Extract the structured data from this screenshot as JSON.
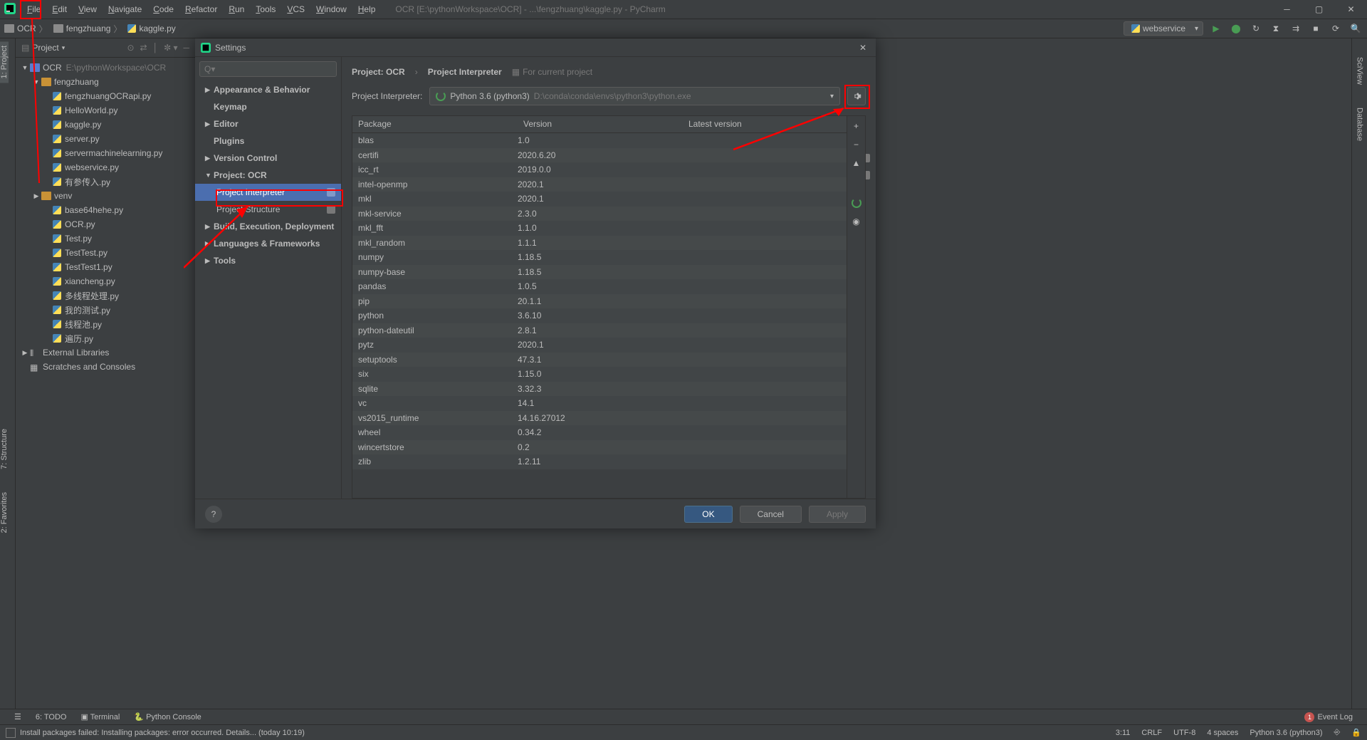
{
  "menu": [
    "File",
    "Edit",
    "View",
    "Navigate",
    "Code",
    "Refactor",
    "Run",
    "Tools",
    "VCS",
    "Window",
    "Help"
  ],
  "title": "OCR [E:\\pythonWorkspace\\OCR] - ...\\fengzhuang\\kaggle.py - PyCharm",
  "breadcrumb": {
    "root": "OCR",
    "folder": "fengzhuang",
    "file": "kaggle.py"
  },
  "run_config": "webservice",
  "project": {
    "header": "Project",
    "root": "OCR",
    "root_path": "E:\\pythonWorkspace\\OCR",
    "fengzhuang": "fengzhuang",
    "files_feng": [
      "fengzhuangOCRapi.py",
      "HelloWorld.py",
      "kaggle.py",
      "server.py",
      "servermachinelearning.py",
      "webservice.py",
      "有参传入.py"
    ],
    "venv": "venv",
    "root_files": [
      "base64hehe.py",
      "OCR.py",
      "Test.py",
      "TestTest.py",
      "TestTest1.py",
      "xiancheng.py",
      "多线程处理.py",
      "我的测试.py",
      "线程池.py",
      "遍历.py"
    ],
    "ext_lib": "External Libraries",
    "scratches": "Scratches and Consoles"
  },
  "dialog": {
    "title": "Settings",
    "search_placeholder": "",
    "tree": {
      "appearance": "Appearance & Behavior",
      "keymap": "Keymap",
      "editor": "Editor",
      "plugins": "Plugins",
      "vcs": "Version Control",
      "project": "Project: OCR",
      "interp": "Project Interpreter",
      "struct": "Project Structure",
      "build": "Build, Execution, Deployment",
      "lang": "Languages & Frameworks",
      "tools": "Tools"
    },
    "bc_project": "Project: OCR",
    "bc_interp": "Project Interpreter",
    "fcp": "For current project",
    "interp_label": "Project Interpreter:",
    "interp_name": "Python 3.6 (python3)",
    "interp_path": "D:\\conda\\conda\\envs\\python3\\python.exe",
    "headers": {
      "pkg": "Package",
      "ver": "Version",
      "lat": "Latest version"
    },
    "packages": [
      {
        "n": "blas",
        "v": "1.0"
      },
      {
        "n": "certifi",
        "v": "2020.6.20"
      },
      {
        "n": "icc_rt",
        "v": "2019.0.0"
      },
      {
        "n": "intel-openmp",
        "v": "2020.1"
      },
      {
        "n": "mkl",
        "v": "2020.1"
      },
      {
        "n": "mkl-service",
        "v": "2.3.0"
      },
      {
        "n": "mkl_fft",
        "v": "1.1.0"
      },
      {
        "n": "mkl_random",
        "v": "1.1.1"
      },
      {
        "n": "numpy",
        "v": "1.18.5"
      },
      {
        "n": "numpy-base",
        "v": "1.18.5"
      },
      {
        "n": "pandas",
        "v": "1.0.5"
      },
      {
        "n": "pip",
        "v": "20.1.1"
      },
      {
        "n": "python",
        "v": "3.6.10"
      },
      {
        "n": "python-dateutil",
        "v": "2.8.1"
      },
      {
        "n": "pytz",
        "v": "2020.1"
      },
      {
        "n": "setuptools",
        "v": "47.3.1"
      },
      {
        "n": "six",
        "v": "1.15.0"
      },
      {
        "n": "sqlite",
        "v": "3.32.3"
      },
      {
        "n": "vc",
        "v": "14.1"
      },
      {
        "n": "vs2015_runtime",
        "v": "14.16.27012"
      },
      {
        "n": "wheel",
        "v": "0.34.2"
      },
      {
        "n": "wincertstore",
        "v": "0.2"
      },
      {
        "n": "zlib",
        "v": "1.2.11"
      }
    ],
    "ok": "OK",
    "cancel": "Cancel",
    "apply": "Apply"
  },
  "left_strip": {
    "project": "1: Project",
    "structure": "7: Structure",
    "favorites": "2: Favorites"
  },
  "right_strip": {
    "sciview": "SciView",
    "database": "Database"
  },
  "bottom": {
    "todo": "6: TODO",
    "terminal": "Terminal",
    "pyconsole": "Python Console",
    "event_log": "Event Log",
    "badge": "1"
  },
  "status": {
    "msg": "Install packages failed: Installing packages: error occurred. Details... (today 10:19)",
    "pos": "3:11",
    "lf": "CRLF",
    "enc": "UTF-8",
    "indent": "4 spaces",
    "py": "Python 3.6 (python3)"
  }
}
